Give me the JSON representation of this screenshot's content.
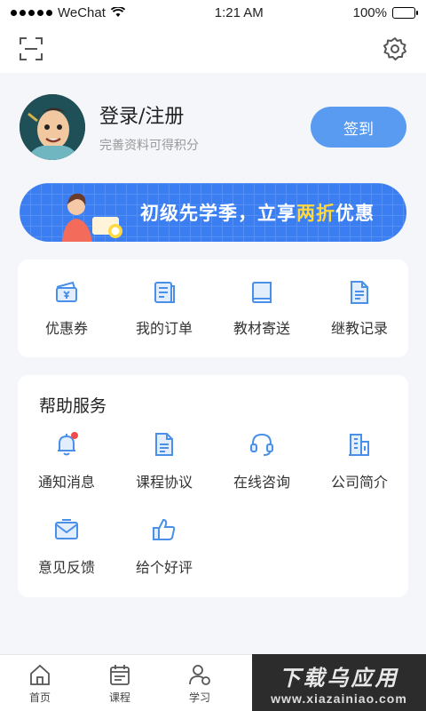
{
  "status_bar": {
    "carrier": "WeChat",
    "time": "1:21 AM",
    "battery": "100%"
  },
  "profile": {
    "title": "登录/注册",
    "subtitle": "完善资料可得积分",
    "signin_label": "签到"
  },
  "banner": {
    "text_main": "初级先学季，立享",
    "text_highlight": "两折",
    "text_end": "优惠"
  },
  "quick_actions": [
    {
      "label": "优惠券",
      "icon": "coupon-icon"
    },
    {
      "label": "我的订单",
      "icon": "order-icon"
    },
    {
      "label": "教材寄送",
      "icon": "book-icon"
    },
    {
      "label": "继教记录",
      "icon": "record-icon"
    }
  ],
  "help": {
    "title": "帮助服务",
    "items": [
      {
        "label": "通知消息",
        "icon": "bell-icon"
      },
      {
        "label": "课程协议",
        "icon": "document-icon"
      },
      {
        "label": "在线咨询",
        "icon": "headset-icon"
      },
      {
        "label": "公司简介",
        "icon": "building-icon"
      },
      {
        "label": "意见反馈",
        "icon": "mail-icon"
      },
      {
        "label": "给个好评",
        "icon": "thumbs-up-icon"
      }
    ]
  },
  "tabs": [
    {
      "label": "首页",
      "icon": "home-icon"
    },
    {
      "label": "课程",
      "icon": "calendar-icon"
    },
    {
      "label": "学习",
      "icon": "user-icon"
    }
  ],
  "watermark": {
    "title": "下载乌应用",
    "url": "www.xiazainiao.com"
  },
  "colors": {
    "accent": "#5a9bf2",
    "icon_blue": "#4a8fe8",
    "background": "#f4f6f9"
  }
}
